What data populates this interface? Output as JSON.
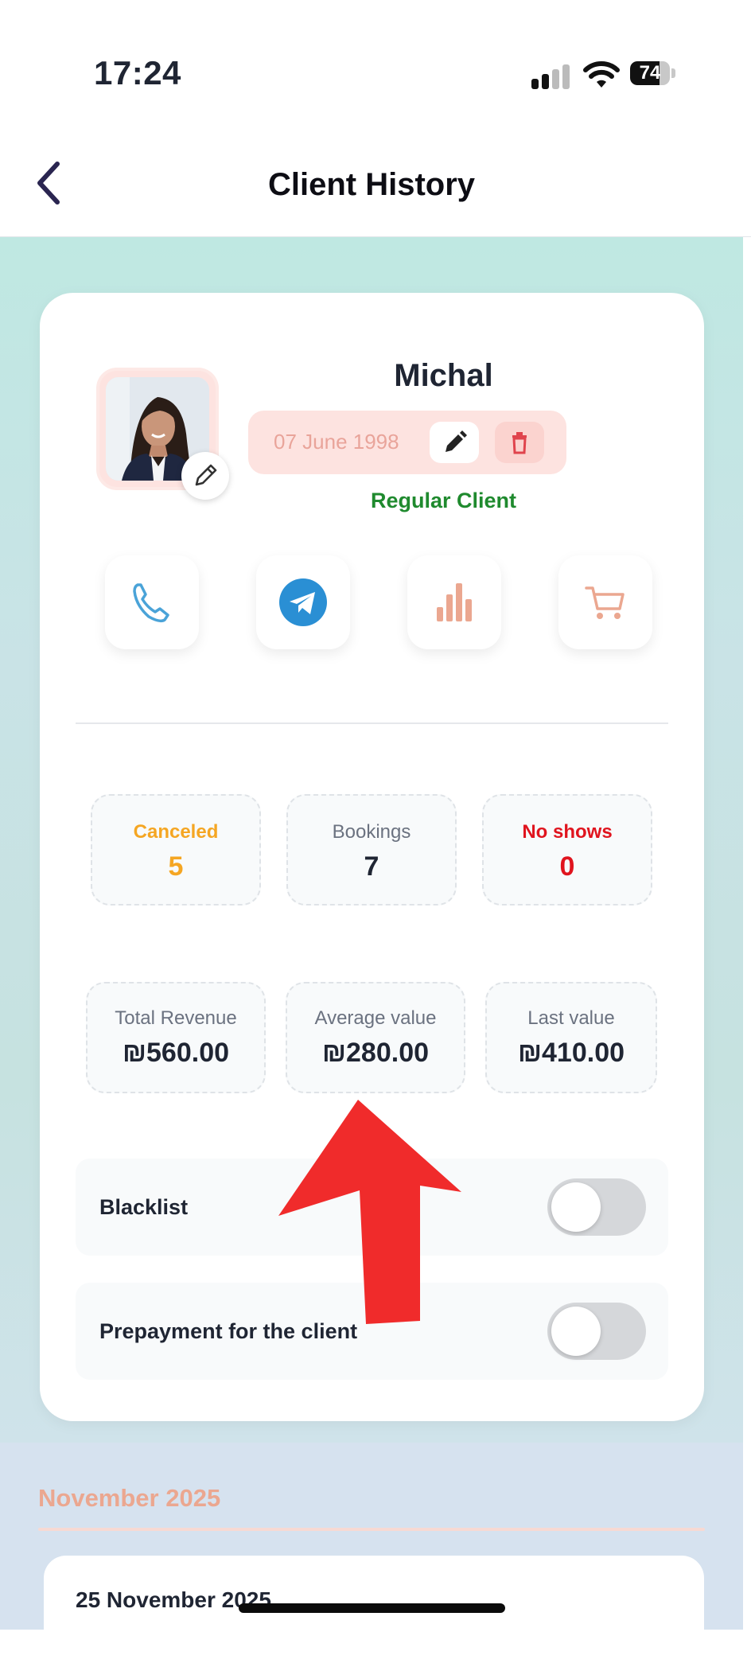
{
  "status_bar": {
    "time": "17:24",
    "battery": "74",
    "battery_level": 0.74
  },
  "header": {
    "title": "Client History"
  },
  "client": {
    "name": "Michal",
    "birth_date": "07 June 1998",
    "type": "Regular Client"
  },
  "actions": [
    {
      "name": "phone",
      "icon": "phone-icon",
      "color": "#4aa3d8"
    },
    {
      "name": "telegram",
      "icon": "telegram-icon",
      "color": "#2a8fd4"
    },
    {
      "name": "statistics",
      "icon": "bar-chart-icon",
      "color": "#eba790"
    },
    {
      "name": "cart",
      "icon": "cart-icon",
      "color": "#eba790"
    }
  ],
  "stats": {
    "canceled": {
      "label": "Canceled",
      "value": "5",
      "color": "#f5a623"
    },
    "bookings": {
      "label": "Bookings",
      "value": "7"
    },
    "no_shows": {
      "label": "No shows",
      "value": "0",
      "color": "#e0141e"
    }
  },
  "revenue": {
    "total": {
      "label": "Total Revenue",
      "value": "₪560.00"
    },
    "average": {
      "label": "Average value",
      "value": "₪280.00"
    },
    "last": {
      "label": "Last value",
      "value": "₪410.00"
    }
  },
  "toggles": {
    "blacklist": {
      "label": "Blacklist",
      "on": false
    },
    "prepayment": {
      "label": "Prepayment for the client",
      "on": false
    }
  },
  "history": {
    "month": "November 2025",
    "entries": [
      {
        "date": "25 November 2025"
      }
    ]
  },
  "overlay": {
    "annotation": "red-arrow",
    "color": "#f02b2b"
  }
}
